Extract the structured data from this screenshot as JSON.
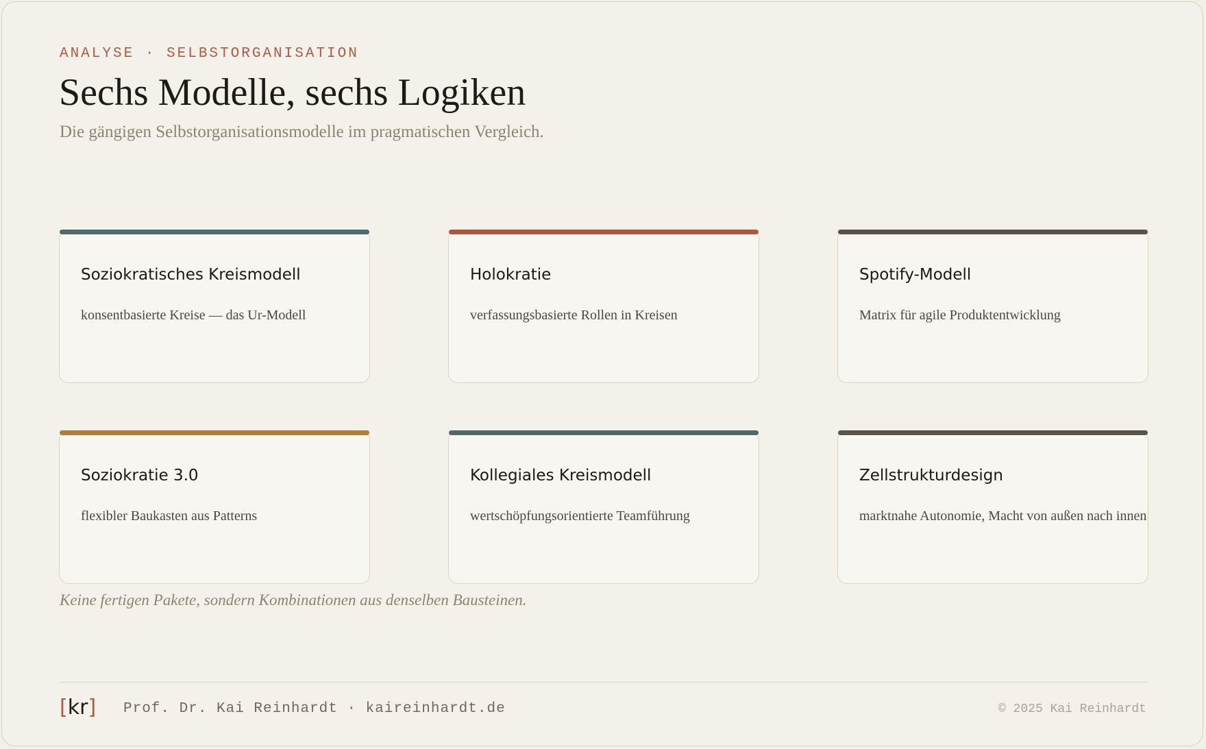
{
  "header": {
    "eyebrow": "ANALYSE · SELBSTORGANISATION",
    "title": "Sechs Modelle, sechs Logiken",
    "subtitle": "Die gängigen Selbstorganisationsmodelle im pragmatischen Vergleich."
  },
  "cards": [
    {
      "title": "Soziokratisches Kreismodell",
      "description": "konsentbasierte Kreise — das Ur-Modell",
      "accent": "#4f6a69"
    },
    {
      "title": "Holokratie",
      "description": "verfassungsbasierte Rollen in Kreisen",
      "accent": "#a9583f"
    },
    {
      "title": "Spotify-Modell",
      "description": "Matrix für agile Produktentwicklung",
      "accent": "#58544c"
    },
    {
      "title": "Soziokratie 3.0",
      "description": "flexibler Baukasten aus Patterns",
      "accent": "#b07d36"
    },
    {
      "title": "Kollegiales Kreismodell",
      "description": "wertschöpfungsorientierte Teamführung",
      "accent": "#4f6a69"
    },
    {
      "title": "Zellstrukturdesign",
      "description": "marktnahe Autonomie, Macht von außen nach innen",
      "accent": "#58544c"
    }
  ],
  "note": "Keine fertigen Pakete, sondern Kombinationen aus denselben Bausteinen.",
  "footer": {
    "logo_open": "[",
    "logo_text": "kr",
    "logo_close": "]",
    "author": "Prof. Dr. Kai Reinhardt · kaireinhardt.de",
    "copyright": "© 2025 Kai Reinhardt"
  },
  "colors": {
    "brand_accent": "#b05a45",
    "background": "#f4f1ea"
  }
}
